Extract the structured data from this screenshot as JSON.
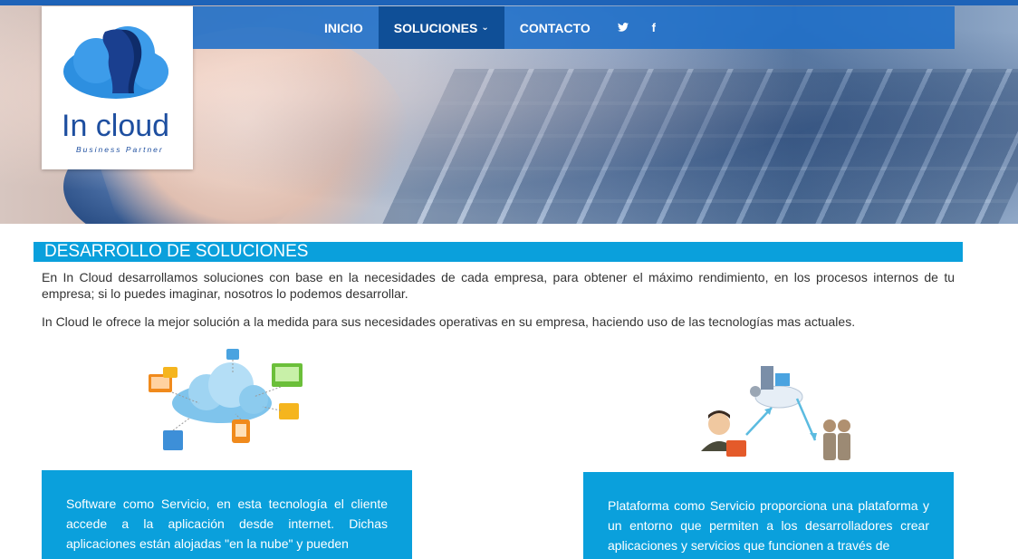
{
  "brand": {
    "name": "In cloud",
    "tagline": "Business Partner"
  },
  "nav": {
    "items": [
      {
        "label": "INICIO"
      },
      {
        "label": "SOLUCIONES"
      },
      {
        "label": "CONTACTO"
      }
    ],
    "active_index": 1,
    "social": [
      {
        "icon": "twitter-icon",
        "glyph": "🐦"
      },
      {
        "icon": "facebook-icon",
        "glyph": "f"
      }
    ]
  },
  "section": {
    "title": "DESARROLLO DE SOLUCIONES",
    "paragraph1": "En In Cloud desarrollamos soluciones con base en la necesidades de cada empresa, para obtener el máximo rendimiento, en los procesos internos de tu empresa; si lo puedes imaginar, nosotros lo podemos desarrollar.",
    "paragraph2": "In Cloud le ofrece la mejor solución a la medida para sus necesidades operativas en su empresa, haciendo uso de las tecnologías mas actuales."
  },
  "cards": [
    {
      "text": "Software como Servicio, en esta tecnología el cliente accede a la aplicación desde internet. Dichas aplicaciones están alojadas \"en la nube\" y pueden"
    },
    {
      "text": "Plataforma como Servicio proporciona una plataforma y un entorno que permiten a los desarrolladores crear aplicaciones y servicios que funcionen a través de"
    }
  ],
  "colors": {
    "accent": "#0aa0dc",
    "nav": "#1e6ec8",
    "nav_active": "#0f4f97",
    "logo_blue": "#1e63b8"
  }
}
